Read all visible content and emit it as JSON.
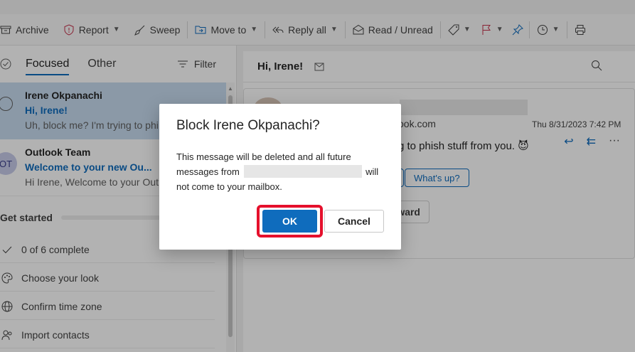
{
  "toolbar": {
    "archive": "Archive",
    "report": "Report",
    "sweep": "Sweep",
    "move_to": "Move to",
    "reply_all": "Reply all",
    "read_unread": "Read / Unread"
  },
  "mail_list": {
    "tab_focused": "Focused",
    "tab_other": "Other",
    "filter": "Filter",
    "messages": [
      {
        "from": "Irene Okpanachi",
        "subject": "Hi, Irene!",
        "preview": "Uh, block me? I'm trying to phi"
      },
      {
        "avatar": "OT",
        "from": "Outlook Team",
        "subject": "Welcome to your new Ou...",
        "preview": "Hi Irene, Welcome to your Out"
      }
    ],
    "get_started": {
      "heading": "Get started",
      "items": [
        "0 of 6 complete",
        "Choose your look",
        "Confirm time zone",
        "Import contacts"
      ]
    }
  },
  "reading_pane": {
    "subject": "Hi, Irene!",
    "email_suffix": "ook.com",
    "date": "Thu 8/31/2023 7:42 PM",
    "body": "g to phish stuff from you. 😈",
    "quick_reply": "What's up?",
    "forward": "ward"
  },
  "dialog": {
    "title": "Block Irene Okpanachi?",
    "text_before": "This message will be deleted and all future messages from",
    "text_after": "will not come to your mailbox.",
    "ok": "OK",
    "cancel": "Cancel"
  },
  "colors": {
    "accent": "#0f6cbd",
    "highlight": "#e5102c",
    "selected_row": "#c7dcf0"
  }
}
